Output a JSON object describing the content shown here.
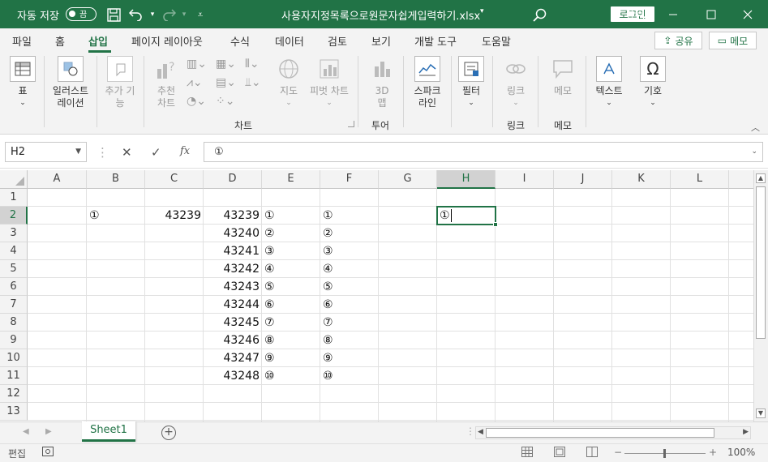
{
  "titlebar": {
    "autosave_label": "자동 저장",
    "autosave_state": "끔",
    "filename": "사용자지정목록으로원문자쉽게입력하기.xlsx",
    "login_label": "로그인"
  },
  "tabs": [
    "파일",
    "홈",
    "삽입",
    "페이지 레이아웃",
    "수식",
    "데이터",
    "검토",
    "보기",
    "개발 도구",
    "도움말"
  ],
  "active_tab": "삽입",
  "share_label": "공유",
  "memo_label": "메모",
  "ribbon": {
    "table": "표",
    "illustrations": [
      "일러스트",
      "레이션"
    ],
    "addins": [
      "추가 기",
      "능"
    ],
    "recommended_charts": [
      "추천",
      "차트"
    ],
    "maps": "지도",
    "pivot_chart": "피벗 차트",
    "three_d": [
      "3D",
      "맵"
    ],
    "sparkline": [
      "스파크",
      "라인"
    ],
    "filter": "필터",
    "link": "링크",
    "comment": "메모",
    "text": "텍스트",
    "symbols": "기호",
    "group_charts": "차트",
    "group_tour": "투어",
    "group_links": "링크",
    "group_comments": "메모"
  },
  "formula_bar": {
    "name_box": "H2",
    "fx_label": "fx",
    "content": "①"
  },
  "columns": [
    "A",
    "B",
    "C",
    "D",
    "E",
    "F",
    "G",
    "H",
    "I",
    "J",
    "K",
    "L"
  ],
  "rows": [
    "1",
    "2",
    "3",
    "4",
    "5",
    "6",
    "7",
    "8",
    "9",
    "10",
    "11",
    "12",
    "13"
  ],
  "cells": {
    "B2": "①",
    "C2": "43239",
    "D2": "43239",
    "D3": "43240",
    "D4": "43241",
    "D5": "43242",
    "D6": "43243",
    "D7": "43244",
    "D8": "43245",
    "D9": "43246",
    "D10": "43247",
    "D11": "43248",
    "E2": "①",
    "E3": "②",
    "E4": "③",
    "E5": "④",
    "E6": "⑤",
    "E7": "⑥",
    "E8": "⑦",
    "E9": "⑧",
    "E10": "⑨",
    "E11": "⑩",
    "F2": "①",
    "F3": "②",
    "F4": "③",
    "F5": "④",
    "F6": "⑤",
    "F7": "⑥",
    "F8": "⑦",
    "F9": "⑧",
    "F10": "⑨",
    "F11": "⑩",
    "H2": "①"
  },
  "active_cell": "H2",
  "sheet_tab": "Sheet1",
  "status": {
    "mode": "편집",
    "zoom": "100%"
  }
}
